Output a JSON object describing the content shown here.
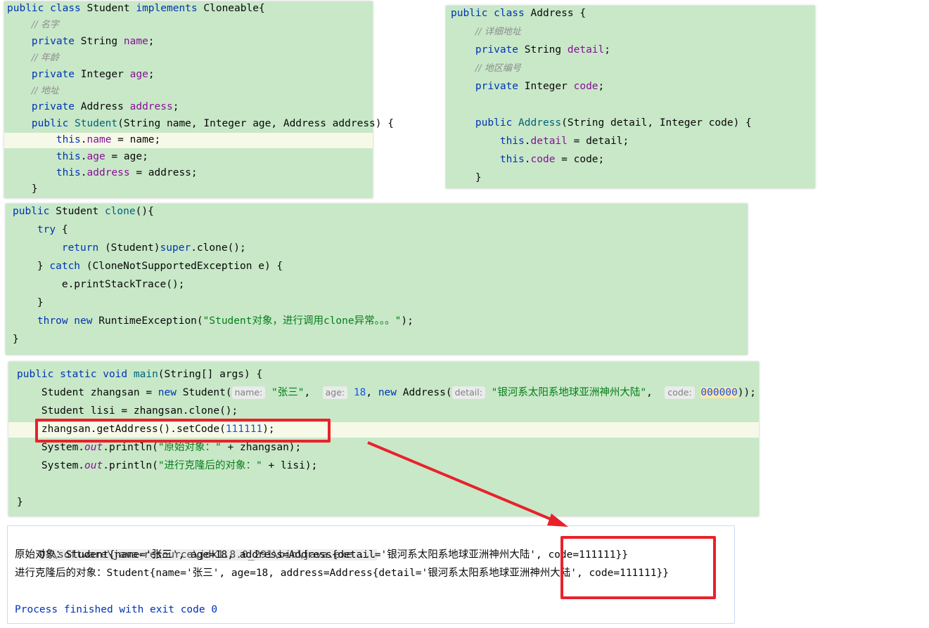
{
  "student_panel": [
    {
      "code": "public class Student implements Cloneable{",
      "parts": [
        [
          "kw",
          "public class "
        ],
        [
          "",
          "Student "
        ],
        [
          "kw",
          "implements "
        ],
        [
          "",
          "Cloneable{"
        ]
      ]
    },
    {
      "parts": [
        [
          "",
          "    "
        ],
        [
          "cmt",
          "// 名字"
        ]
      ]
    },
    {
      "parts": [
        [
          "",
          "    "
        ],
        [
          "kw",
          "private "
        ],
        [
          "",
          "String "
        ],
        [
          "fld",
          "name"
        ],
        [
          "",
          ";"
        ]
      ]
    },
    {
      "parts": [
        [
          "",
          "    "
        ],
        [
          "cmt",
          "// 年龄"
        ]
      ]
    },
    {
      "parts": [
        [
          "",
          "    "
        ],
        [
          "kw",
          "private "
        ],
        [
          "",
          "Integer "
        ],
        [
          "fld",
          "age"
        ],
        [
          "",
          ";"
        ]
      ]
    },
    {
      "parts": [
        [
          "",
          "    "
        ],
        [
          "cmt",
          "// 地址"
        ]
      ]
    },
    {
      "parts": [
        [
          "",
          "    "
        ],
        [
          "kw",
          "private "
        ],
        [
          "",
          "Address "
        ],
        [
          "fld",
          "address"
        ],
        [
          "",
          ";"
        ]
      ]
    },
    {
      "parts": [
        [
          "",
          "    "
        ],
        [
          "kw",
          "public "
        ],
        [
          "fn",
          "Student"
        ],
        [
          "",
          "(String name, Integer age, Address address) {"
        ]
      ]
    },
    {
      "hl": true,
      "parts": [
        [
          "",
          "        "
        ],
        [
          "kw",
          "this"
        ],
        [
          "",
          "."
        ],
        [
          "fld",
          "name"
        ],
        [
          "",
          " = name;"
        ]
      ]
    },
    {
      "parts": [
        [
          "",
          "        "
        ],
        [
          "kw",
          "this"
        ],
        [
          "",
          "."
        ],
        [
          "fld",
          "age"
        ],
        [
          "",
          " = age;"
        ]
      ]
    },
    {
      "parts": [
        [
          "",
          "        "
        ],
        [
          "kw",
          "this"
        ],
        [
          "",
          "."
        ],
        [
          "fld",
          "address"
        ],
        [
          "",
          " = address;"
        ]
      ]
    },
    {
      "parts": [
        [
          "",
          "    }"
        ]
      ]
    }
  ],
  "address_panel": [
    {
      "parts": [
        [
          "kw",
          "public class "
        ],
        [
          "",
          "Address {"
        ]
      ]
    },
    {
      "parts": [
        [
          "",
          "    "
        ],
        [
          "cmt",
          "// 详细地址"
        ]
      ]
    },
    {
      "parts": [
        [
          "",
          "    "
        ],
        [
          "kw",
          "private "
        ],
        [
          "",
          "String "
        ],
        [
          "fld",
          "detail"
        ],
        [
          "",
          ";"
        ]
      ]
    },
    {
      "parts": [
        [
          "",
          "    "
        ],
        [
          "cmt",
          "// 地区编号"
        ]
      ]
    },
    {
      "parts": [
        [
          "",
          "    "
        ],
        [
          "kw",
          "private "
        ],
        [
          "",
          "Integer "
        ],
        [
          "fld",
          "code"
        ],
        [
          "",
          ";"
        ]
      ]
    },
    {
      "parts": [
        [
          "",
          ""
        ]
      ]
    },
    {
      "parts": [
        [
          "",
          "    "
        ],
        [
          "kw",
          "public "
        ],
        [
          "fn",
          "Address"
        ],
        [
          "",
          "(String detail, Integer code) {"
        ]
      ]
    },
    {
      "parts": [
        [
          "",
          "        "
        ],
        [
          "kw",
          "this"
        ],
        [
          "",
          "."
        ],
        [
          "fld",
          "detail"
        ],
        [
          "",
          " = detail;"
        ]
      ]
    },
    {
      "parts": [
        [
          "",
          "        "
        ],
        [
          "kw",
          "this"
        ],
        [
          "",
          "."
        ],
        [
          "fld",
          "code"
        ],
        [
          "",
          " = code;"
        ]
      ]
    },
    {
      "parts": [
        [
          "",
          "    }"
        ]
      ]
    }
  ],
  "clone_panel": [
    {
      "parts": [
        [
          "kw",
          "public "
        ],
        [
          "",
          "Student "
        ],
        [
          "fn",
          "clone"
        ],
        [
          "",
          "(){"
        ]
      ]
    },
    {
      "parts": [
        [
          "",
          "    "
        ],
        [
          "kw",
          "try "
        ],
        [
          "",
          "{"
        ]
      ]
    },
    {
      "parts": [
        [
          "",
          "        "
        ],
        [
          "kw",
          "return "
        ],
        [
          "",
          "(Student)"
        ],
        [
          "kw",
          "super"
        ],
        [
          "",
          ".clone();"
        ]
      ]
    },
    {
      "parts": [
        [
          "",
          "    } "
        ],
        [
          "kw",
          "catch "
        ],
        [
          "",
          "(CloneNotSupportedException e) {"
        ]
      ]
    },
    {
      "parts": [
        [
          "",
          "        e.printStackTrace();"
        ]
      ]
    },
    {
      "parts": [
        [
          "",
          "    }"
        ]
      ]
    },
    {
      "parts": [
        [
          "",
          "    "
        ],
        [
          "kw",
          "throw new "
        ],
        [
          "",
          "RuntimeException("
        ],
        [
          "str",
          "\"Student对象，进行调用clone异常。。。\""
        ],
        [
          "",
          ");"
        ]
      ]
    },
    {
      "parts": [
        [
          "",
          "}"
        ]
      ]
    }
  ],
  "main_panel": [
    {
      "parts": [
        [
          "kw",
          "public static void "
        ],
        [
          "fn",
          "main"
        ],
        [
          "",
          "(String[] args) {"
        ]
      ]
    },
    {
      "parts": [
        [
          "",
          "    Student zhangsan = "
        ],
        [
          "kw",
          "new "
        ],
        [
          "",
          "Student("
        ],
        [
          "hint",
          "name:"
        ],
        [
          "",
          " "
        ],
        [
          "str",
          "\"张三\""
        ],
        [
          "",
          ",  "
        ],
        [
          "hint",
          "age:"
        ],
        [
          "",
          " "
        ],
        [
          "num",
          "18"
        ],
        [
          "",
          ", "
        ],
        [
          "kw",
          "new "
        ],
        [
          "",
          "Address("
        ],
        [
          "hint",
          "detail:"
        ],
        [
          "",
          " "
        ],
        [
          "str",
          "\"银河系太阳系地球亚洲神州大陆\""
        ],
        [
          "",
          ",  "
        ],
        [
          "hint",
          "code:"
        ],
        [
          "",
          " "
        ],
        [
          "caretnum",
          "000000"
        ],
        [
          "",
          "));"
        ]
      ]
    },
    {
      "parts": [
        [
          "",
          "    Student lisi = zhangsan.clone();"
        ]
      ]
    },
    {
      "hl": true,
      "parts": [
        [
          "",
          "    zhangsan.getAddress().setCode("
        ],
        [
          "num",
          "111111"
        ],
        [
          "",
          ");"
        ]
      ]
    },
    {
      "parts": [
        [
          "",
          "    System."
        ],
        [
          "fldit",
          "out"
        ],
        [
          "",
          ".println("
        ],
        [
          "str",
          "\"原始对象：\""
        ],
        [
          "",
          " + zhangsan);"
        ]
      ]
    },
    {
      "parts": [
        [
          "",
          "    System."
        ],
        [
          "fldit",
          "out"
        ],
        [
          "",
          ".println("
        ],
        [
          "str",
          "\"进行克隆后的对象：\""
        ],
        [
          "",
          " + lisi);"
        ]
      ]
    },
    {
      "parts": [
        [
          "",
          ""
        ]
      ]
    },
    {
      "parts": [
        [
          "",
          "}"
        ]
      ]
    }
  ],
  "console": {
    "path": "D:\\software\\java-resource\\jdk1.8.0_291\\bin\\java.exe ...",
    "line1": "原始对象：Student{name='张三', age=18, address=Address{detail='银河系太阳系地球亚洲神州大陆', code=111111}}",
    "line2": "进行克隆后的对象：Student{name='张三', age=18, address=Address{detail='银河系太阳系地球亚洲神州大陆', code=111111}}",
    "exit": "Process finished with exit code 0"
  },
  "colors": {
    "annotation": "#e8222a",
    "panel_bg": "#c8e8c8"
  }
}
